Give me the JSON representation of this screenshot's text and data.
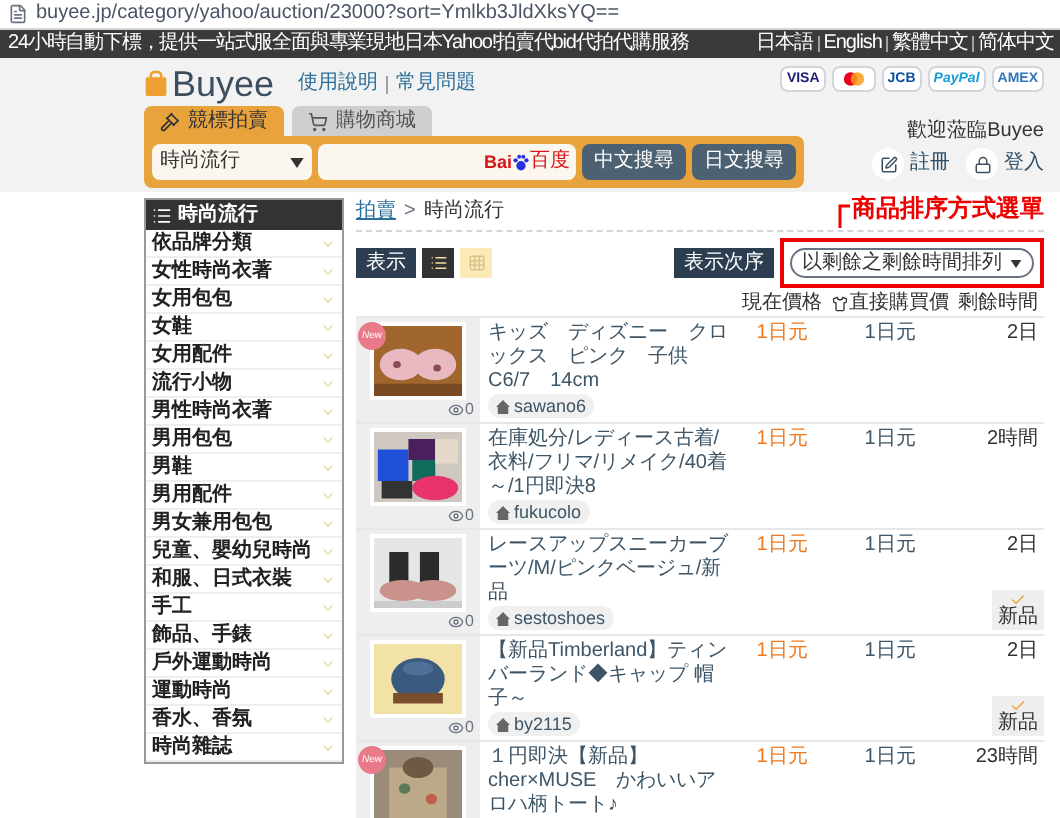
{
  "address_bar": {
    "url": "buyee.jp/category/yahoo/auction/23000?sort=Ymlkb3JldXksYQ=="
  },
  "top_bar": {
    "tagline": "24小時自動下標，提供一站式服全面與專業現地日本Yahoo!拍賣代bid代拍代購服務",
    "languages": [
      "日本語",
      "English",
      "繁體中文",
      "简体中文"
    ]
  },
  "header": {
    "logo": "Buyee",
    "links": [
      "使用說明",
      "常見問題"
    ],
    "payment_methods": [
      {
        "kind": "visa",
        "label": "VISA"
      },
      {
        "kind": "mastercard"
      },
      {
        "kind": "jcb",
        "label": "JCB"
      },
      {
        "kind": "paypal",
        "label": "PayPal"
      },
      {
        "kind": "amex",
        "label": "AMEX"
      }
    ]
  },
  "tabs": [
    {
      "kind": "auction",
      "label": "競標拍賣",
      "selected": true
    },
    {
      "kind": "shopping",
      "label": "購物商城",
      "selected": false
    }
  ],
  "search": {
    "category": "時尚流行",
    "engine": "Bai",
    "engine_suffix": "百度",
    "buttons": [
      "中文搜尋",
      "日文搜尋"
    ]
  },
  "user": {
    "welcome": "歡迎蒞臨Buyee",
    "actions": [
      {
        "kind": "register",
        "label": "註冊"
      },
      {
        "kind": "login",
        "label": "登入"
      }
    ]
  },
  "sidebar": {
    "title": "時尚流行",
    "items": [
      "依品牌分類",
      "女性時尚衣著",
      "女用包包",
      "女鞋",
      "女用配件",
      "流行小物",
      "男性時尚衣著",
      "男用包包",
      "男鞋",
      "男用配件",
      "男女兼用包包",
      "兒童、嬰幼兒時尚",
      "和服、日式衣裝",
      "手工",
      "飾品、手錶",
      "戶外運動時尚",
      "運動時尚",
      "香水、香氛",
      "時尚雜誌"
    ]
  },
  "breadcrumb": {
    "items": [
      "拍賣",
      "時尚流行"
    ],
    "separator": ">"
  },
  "annotation": {
    "label": "商品排序方式選單"
  },
  "view": {
    "label": "表示",
    "modes": [
      {
        "kind": "list",
        "selected": true
      },
      {
        "kind": "grid",
        "selected": false
      }
    ]
  },
  "sort": {
    "label": "表示次序",
    "value": "以剩餘之剩餘時間排列"
  },
  "columns": [
    "現在價格",
    "直接購買價",
    "剩餘時間"
  ],
  "listings": [
    {
      "kind": "shoes",
      "badge": "New",
      "title": "キッズ　ディズニー　クロックス　ピンク　子供　C6/7　14cm",
      "price": "1日元",
      "buy_now": "1日元",
      "time_left": "2日",
      "seller": "sawano6",
      "watchers": "0"
    },
    {
      "kind": "clothes",
      "title": "在庫処分/レディース古着/衣料/フリマ/リメイク/40着～/1円即決8",
      "price": "1日元",
      "buy_now": "1日元",
      "time_left": "2時間",
      "seller": "fukucolo",
      "watchers": "0"
    },
    {
      "kind": "boots",
      "title": "レースアップスニーカーブーツ/M/ピンクベージュ/新品",
      "price": "1日元",
      "buy_now": "1日元",
      "time_left": "2日",
      "seller": "sestoshoes",
      "watchers": "0",
      "condition": "新品"
    },
    {
      "kind": "cap",
      "title": "【新品Timberland】ティンバーランド◆キャップ 帽子～",
      "price": "1日元",
      "buy_now": "1日元",
      "time_left": "2日",
      "seller": "by2115",
      "watchers": "0",
      "condition": "新品"
    },
    {
      "kind": "bag",
      "badge": "New",
      "title": "１円即決【新品】　cher×MUSE　かわいいアロハ柄トート♪",
      "price": "1日元",
      "buy_now": "1日元",
      "time_left": "23時間"
    }
  ]
}
